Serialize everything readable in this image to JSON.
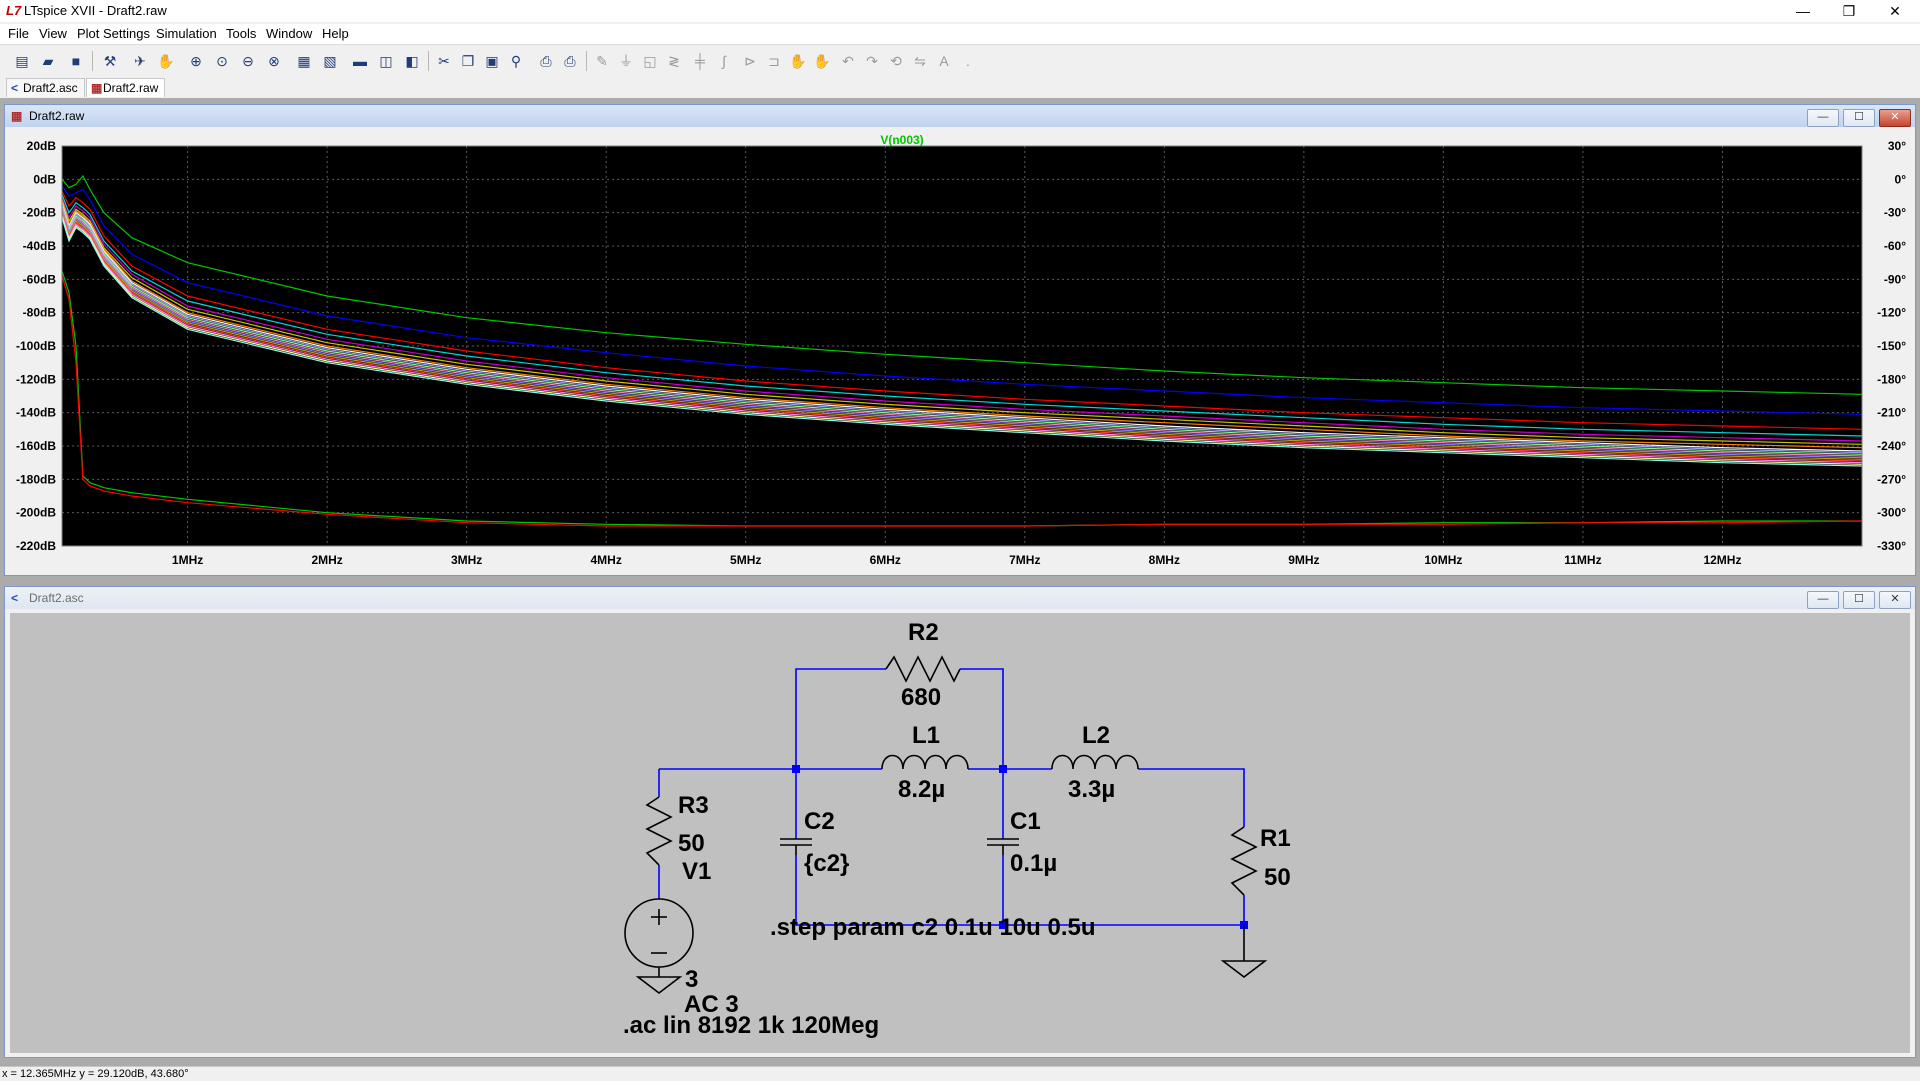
{
  "window": {
    "title": "LTspice XVII - Draft2.raw",
    "controls": {
      "minimize": "—",
      "restore": "❐",
      "close": "✕"
    }
  },
  "menu": [
    "File",
    "View",
    "Plot Settings",
    "Simulation",
    "Tools",
    "Window",
    "Help"
  ],
  "tabs": [
    "Draft2.asc",
    "Draft2.raw"
  ],
  "waveform_window": {
    "title": "Draft2.raw",
    "trace_label": "V(n003)",
    "trace_label_color": "#00c800"
  },
  "schematic_window": {
    "title": "Draft2.asc"
  },
  "colors": {
    "plot_bg": "#000000",
    "grid": "#5a5a5a",
    "trace_main": "#00c800",
    "schematic_bg": "#c0c0c0",
    "wire": "#0000ff",
    "component": "#000000"
  },
  "chart_data": {
    "type": "line",
    "title": "",
    "trace": "V(n003)",
    "x_ticks": [
      "1MHz",
      "2MHz",
      "3MHz",
      "4MHz",
      "5MHz",
      "6MHz",
      "7MHz",
      "8MHz",
      "9MHz",
      "10MHz",
      "11MHz",
      "12MHz"
    ],
    "x_tick_values": [
      1,
      2,
      3,
      4,
      5,
      6,
      7,
      8,
      9,
      10,
      11,
      12
    ],
    "xlim": [
      0.1,
      13
    ],
    "y_ticks": [
      "20dB",
      "0dB",
      "-20dB",
      "-40dB",
      "-60dB",
      "-80dB",
      "-100dB",
      "-120dB",
      "-140dB",
      "-160dB",
      "-180dB",
      "-200dB",
      "-220dB"
    ],
    "y_tick_values": [
      20,
      0,
      -20,
      -40,
      -60,
      -80,
      -100,
      -120,
      -140,
      -160,
      -180,
      -200,
      -220
    ],
    "ylim": [
      -220,
      20
    ],
    "y2_ticks": [
      "30°",
      "0°",
      "-30°",
      "-60°",
      "-90°",
      "-120°",
      "-150°",
      "-180°",
      "-210°",
      "-240°",
      "-270°",
      "-300°",
      "-330°"
    ],
    "y2lim": [
      -330,
      30
    ],
    "grid": true,
    "x": [
      0.1,
      0.15,
      0.2,
      0.25,
      0.3,
      0.4,
      0.6,
      1,
      2,
      3,
      4,
      5,
      6,
      7,
      8,
      9,
      10,
      11,
      12,
      13
    ],
    "series": [
      {
        "color": "#00c800",
        "values": [
          0,
          -5,
          -3,
          2,
          -6,
          -20,
          -35,
          -50,
          -70,
          -83,
          -92,
          -99,
          -105,
          -110,
          -115,
          -119,
          -122,
          -125,
          -127,
          -129
        ]
      },
      {
        "color": "#0000ff",
        "values": [
          -4,
          -10,
          -8,
          -6,
          -12,
          -28,
          -45,
          -62,
          -82,
          -95,
          -104,
          -112,
          -118,
          -123,
          -127,
          -131,
          -134,
          -137,
          -139,
          -141
        ]
      },
      {
        "color": "#ff0000",
        "values": [
          -7,
          -16,
          -11,
          -14,
          -18,
          -34,
          -52,
          -70,
          -90,
          -103,
          -113,
          -121,
          -127,
          -132,
          -136,
          -140,
          -143,
          -146,
          -148,
          -150
        ]
      },
      {
        "color": "#00d7d7",
        "values": [
          -9,
          -20,
          -14,
          -17,
          -21,
          -37,
          -55,
          -73,
          -93,
          -106,
          -116,
          -124,
          -130,
          -135,
          -139,
          -143,
          -147,
          -150,
          -152,
          -154
        ]
      },
      {
        "color": "#c800c8",
        "values": [
          -11,
          -23,
          -16,
          -19,
          -23,
          -39,
          -57,
          -76,
          -96,
          -109,
          -119,
          -127,
          -133,
          -138,
          -142,
          -146,
          -150,
          -153,
          -155,
          -157
        ]
      },
      {
        "color": "#c8c800",
        "values": [
          -12,
          -25,
          -18,
          -21,
          -25,
          -41,
          -59,
          -78,
          -98,
          -111,
          -121,
          -129,
          -135,
          -140,
          -144,
          -148,
          -152,
          -155,
          -157,
          -159
        ]
      },
      {
        "color": "#ff8000",
        "values": [
          -13,
          -27,
          -19,
          -22,
          -26,
          -42,
          -61,
          -80,
          -100,
          -113,
          -123,
          -131,
          -137,
          -142,
          -146,
          -150,
          -154,
          -157,
          -159,
          -161
        ]
      },
      {
        "color": "#ffffff",
        "values": [
          -14,
          -28,
          -20,
          -23,
          -27,
          -43,
          -62,
          -81,
          -101,
          -114,
          -124,
          -132,
          -138,
          -143,
          -148,
          -152,
          -155,
          -158,
          -161,
          -163
        ]
      },
      {
        "color": "#a0a0ff",
        "values": [
          -15,
          -29,
          -21,
          -24,
          -28,
          -44,
          -63,
          -82,
          -102,
          -115,
          -125,
          -133,
          -139,
          -144,
          -149,
          -153,
          -156,
          -159,
          -162,
          -164
        ]
      },
      {
        "color": "#80ff80",
        "values": [
          -16,
          -30,
          -22,
          -25,
          -29,
          -45,
          -64,
          -83,
          -103,
          -116,
          -126,
          -134,
          -140,
          -145,
          -150,
          -154,
          -157,
          -160,
          -163,
          -165
        ]
      },
      {
        "color": "#ff80c0",
        "values": [
          -17,
          -31,
          -23,
          -26,
          -30,
          -46,
          -65,
          -84,
          -104,
          -117,
          -127,
          -135,
          -141,
          -146,
          -151,
          -155,
          -158,
          -161,
          -164,
          -166
        ]
      },
      {
        "color": "#8080ff",
        "values": [
          -18,
          -32,
          -24,
          -27,
          -31,
          -47,
          -66,
          -85,
          -105,
          -118,
          -128,
          -136,
          -142,
          -147,
          -152,
          -156,
          -159,
          -162,
          -165,
          -167
        ]
      },
      {
        "color": "#c0a000",
        "values": [
          -19,
          -33,
          -25,
          -28,
          -32,
          -48,
          -67,
          -86,
          -106,
          -119,
          -129,
          -137,
          -143,
          -148,
          -153,
          -157,
          -160,
          -163,
          -166,
          -168
        ]
      },
      {
        "color": "#ff4040",
        "values": [
          -20,
          -34,
          -26,
          -29,
          -33,
          -49,
          -68,
          -87,
          -107,
          -120,
          -130,
          -138,
          -144,
          -149,
          -154,
          -158,
          -161,
          -164,
          -167,
          -169
        ]
      },
      {
        "color": "#ff80ff",
        "values": [
          -21,
          -35,
          -27,
          -30,
          -34,
          -50,
          -69,
          -88,
          -108,
          -121,
          -131,
          -139,
          -145,
          -150,
          -155,
          -159,
          -162,
          -165,
          -168,
          -170
        ]
      },
      {
        "color": "#ffff80",
        "values": [
          -22,
          -36,
          -28,
          -31,
          -35,
          -51,
          -70,
          -89,
          -109,
          -122,
          -132,
          -140,
          -146,
          -151,
          -156,
          -160,
          -163,
          -166,
          -169,
          -171
        ]
      },
      {
        "color": "#80ffff",
        "values": [
          -23,
          -37,
          -29,
          -32,
          -36,
          -52,
          -71,
          -90,
          -110,
          -123,
          -133,
          -141,
          -147,
          -152,
          -157,
          -161,
          -164,
          -167,
          -170,
          -172
        ]
      },
      {
        "color": "#00c800",
        "values": [
          -55,
          -68,
          -100,
          -178,
          -182,
          -185,
          -188,
          -192,
          -200,
          -205,
          -207,
          -208,
          -208,
          -208,
          -207,
          -207,
          -206,
          -206,
          -205,
          -205
        ]
      },
      {
        "color": "#ff0000",
        "values": [
          -58,
          -72,
          -110,
          -180,
          -184,
          -187,
          -190,
          -194,
          -201,
          -206,
          -208,
          -208,
          -208,
          -208,
          -207,
          -207,
          -207,
          -206,
          -206,
          -205
        ]
      }
    ]
  },
  "schematic": {
    "components": {
      "R2": {
        "name": "R2",
        "value": "680"
      },
      "L1": {
        "name": "L1",
        "value": "8.2µ"
      },
      "L2": {
        "name": "L2",
        "value": "3.3µ"
      },
      "R3": {
        "name": "R3",
        "value": "50"
      },
      "C2": {
        "name": "C2",
        "value": "{c2}"
      },
      "C1": {
        "name": "C1",
        "value": "0.1µ"
      },
      "R1": {
        "name": "R1",
        "value": "50"
      },
      "V1": {
        "name": "V1",
        "value": "3",
        "ac": "AC 3"
      }
    },
    "directives": [
      ".step param c2 0.1u 10u 0.5u",
      ".ac lin 8192 1k 120Meg"
    ]
  },
  "status": {
    "text": "x = 12.365MHz    y = 29.120dB, 43.680°"
  }
}
